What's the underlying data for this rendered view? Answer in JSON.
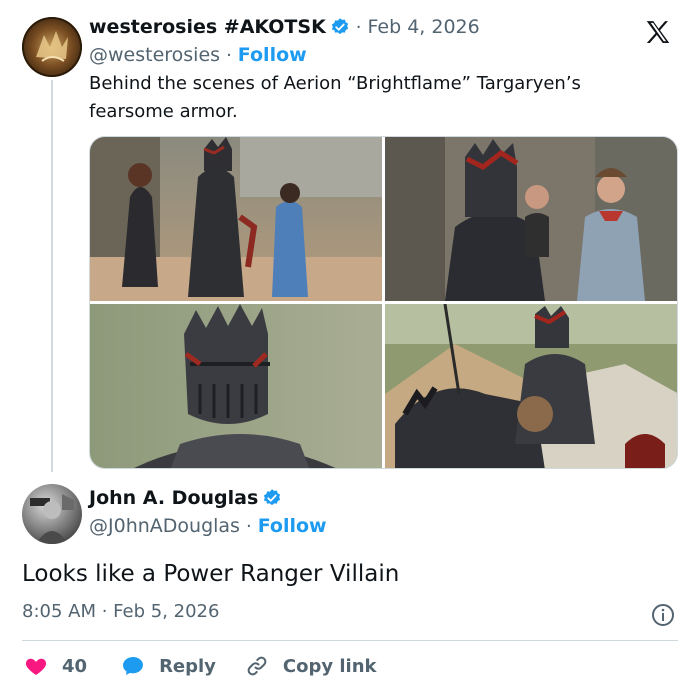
{
  "colors": {
    "accent": "#1d9bf0",
    "like": "#f91880",
    "muted": "#536471",
    "text": "#0f1419"
  },
  "tweet": {
    "display_name": "westerosies #AKOTSK",
    "handle": "@westerosies",
    "separator": "·",
    "date": "Feb 4, 2026",
    "follow_label": "Follow",
    "text": "Behind the scenes of Aerion “Brightflame” Targaryen’s fearsome armor.",
    "verified_icon": "verified-badge-icon",
    "platform_icon": "x-logo-icon"
  },
  "reply": {
    "display_name": "John A. Douglas",
    "handle": "@J0hnADouglas",
    "separator": "·",
    "follow_label": "Follow",
    "text": "Looks like a Power Ranger Villain",
    "timestamp": "8:05 AM · Feb 5, 2026",
    "info_icon": "info-icon"
  },
  "actions": {
    "like_count": "40",
    "reply_label": "Reply",
    "copy_link_label": "Copy link",
    "like_icon": "heart-icon",
    "reply_icon": "reply-bubble-icon",
    "link_icon": "link-icon"
  }
}
